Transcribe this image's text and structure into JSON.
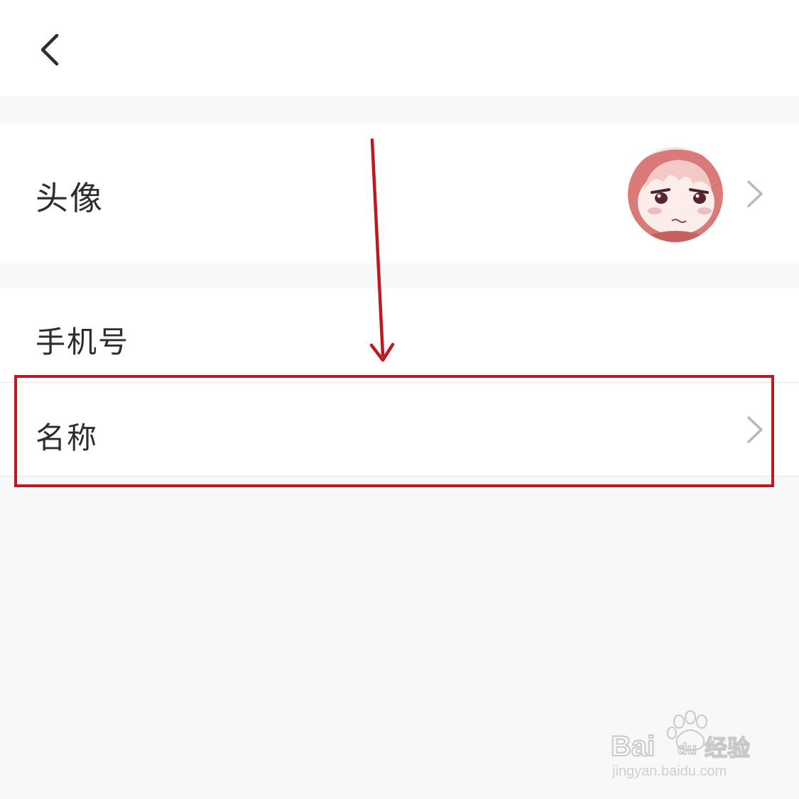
{
  "header": {
    "back_icon": "chevron-left-icon"
  },
  "rows": [
    {
      "label": "头像",
      "trailing": "avatar-image",
      "chevron": "chevron-right-icon"
    },
    {
      "label": "手机号"
    },
    {
      "label": "名称",
      "chevron": "chevron-right-icon"
    }
  ],
  "annotation": {
    "arrow_color": "#c0181f",
    "box_color": "#c0181f"
  },
  "watermark": {
    "brand": "Bai du 经验",
    "url": "jingyan.baidu.com"
  },
  "colors": {
    "background": "#f7f8fa",
    "row_background": "#ffffff",
    "label_text": "#2b2d33",
    "chevron": "#b8b8bd"
  }
}
